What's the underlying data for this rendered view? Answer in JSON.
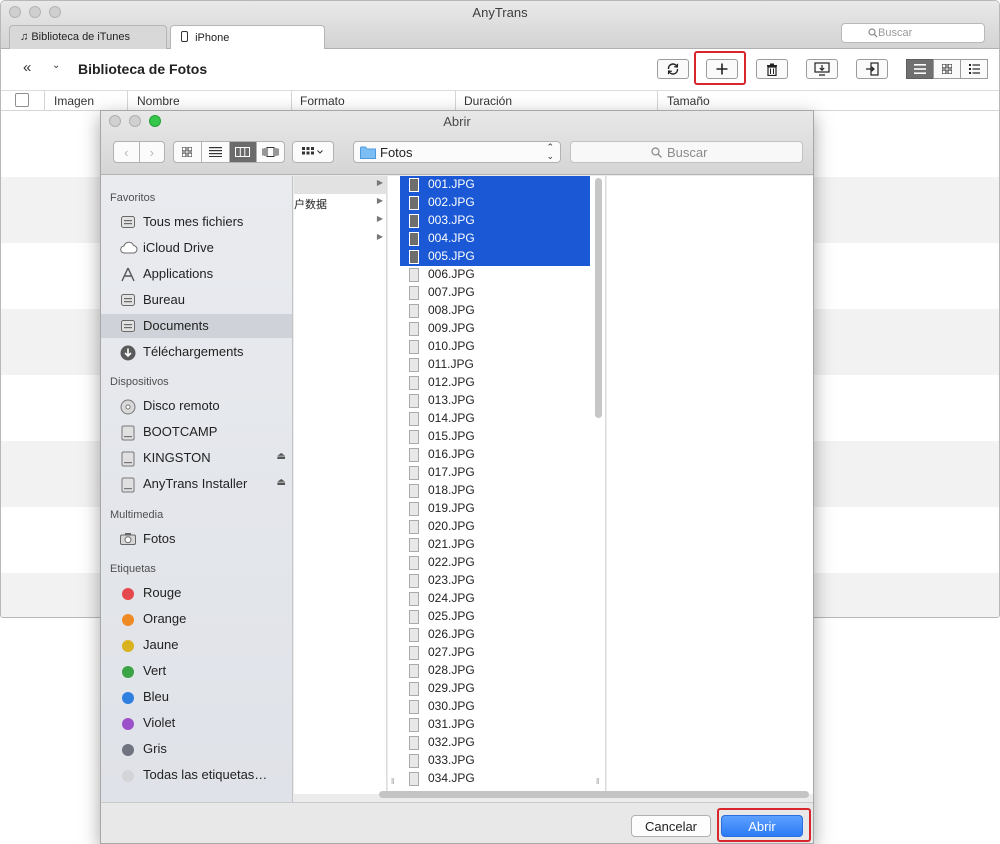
{
  "app": {
    "title": "AnyTrans",
    "tabs": [
      {
        "label": "Biblioteca de iTunes",
        "icon": "music-note-icon"
      },
      {
        "label": "iPhone",
        "icon": "iphone-icon"
      }
    ],
    "search_placeholder": "Buscar"
  },
  "toolbar": {
    "page_title": "Biblioteca de Fotos",
    "buttons": [
      "refresh-icon",
      "add-icon",
      "trash-icon",
      "to-computer-icon",
      "to-device-icon"
    ],
    "view_modes": [
      "list-view-icon",
      "grid-view-icon",
      "detail-view-icon"
    ],
    "highlight_color": "#d9262c"
  },
  "table": {
    "columns": [
      "Imagen",
      "Nombre",
      "Formato",
      "Duración",
      "Tamaño"
    ]
  },
  "dialog": {
    "title": "Abrir",
    "location": "Fotos",
    "search_placeholder": "Buscar",
    "sidebar": {
      "sections": [
        {
          "title": "Favoritos",
          "items": [
            {
              "label": "Tous mes fichiers",
              "icon": "all-files-icon"
            },
            {
              "label": "iCloud Drive",
              "icon": "cloud-icon"
            },
            {
              "label": "Applications",
              "icon": "applications-icon"
            },
            {
              "label": "Bureau",
              "icon": "desktop-icon"
            },
            {
              "label": "Documents",
              "icon": "documents-icon",
              "selected": true
            },
            {
              "label": "Téléchargements",
              "icon": "downloads-icon"
            }
          ]
        },
        {
          "title": "Dispositivos",
          "items": [
            {
              "label": "Disco remoto",
              "icon": "disc-icon"
            },
            {
              "label": "BOOTCAMP",
              "icon": "hard-drive-icon"
            },
            {
              "label": "KINGSTON",
              "icon": "drive-icon",
              "eject": true
            },
            {
              "label": "AnyTrans Installer",
              "icon": "drive-icon",
              "eject": true
            }
          ]
        },
        {
          "title": "Multimedia",
          "items": [
            {
              "label": "Fotos",
              "icon": "camera-icon"
            }
          ]
        },
        {
          "title": "Etiquetas",
          "items": [
            {
              "label": "Rouge",
              "color": "#e5484d"
            },
            {
              "label": "Orange",
              "color": "#f08a24"
            },
            {
              "label": "Jaune",
              "color": "#d9b21f"
            },
            {
              "label": "Vert",
              "color": "#3aa546"
            },
            {
              "label": "Bleu",
              "color": "#2f7fe0"
            },
            {
              "label": "Violet",
              "color": "#9b51c8"
            },
            {
              "label": "Gris",
              "color": "#6f7480"
            },
            {
              "label": "Todas las etiquetas…",
              "color": "#d2d4d8"
            }
          ]
        }
      ]
    },
    "column1": [
      "",
      "户数据",
      "",
      ""
    ],
    "files": [
      {
        "name": "001.JPG",
        "selected": true
      },
      {
        "name": "002.JPG",
        "selected": true
      },
      {
        "name": "003.JPG",
        "selected": true
      },
      {
        "name": "004.JPG",
        "selected": true
      },
      {
        "name": "005.JPG",
        "selected": true
      },
      {
        "name": "006.JPG"
      },
      {
        "name": "007.JPG"
      },
      {
        "name": "008.JPG"
      },
      {
        "name": "009.JPG"
      },
      {
        "name": "010.JPG"
      },
      {
        "name": "011.JPG"
      },
      {
        "name": "012.JPG"
      },
      {
        "name": "013.JPG"
      },
      {
        "name": "014.JPG"
      },
      {
        "name": "015.JPG"
      },
      {
        "name": "016.JPG"
      },
      {
        "name": "017.JPG"
      },
      {
        "name": "018.JPG"
      },
      {
        "name": "019.JPG"
      },
      {
        "name": "020.JPG"
      },
      {
        "name": "021.JPG"
      },
      {
        "name": "022.JPG"
      },
      {
        "name": "023.JPG"
      },
      {
        "name": "024.JPG"
      },
      {
        "name": "025.JPG"
      },
      {
        "name": "026.JPG"
      },
      {
        "name": "027.JPG"
      },
      {
        "name": "028.JPG"
      },
      {
        "name": "029.JPG"
      },
      {
        "name": "030.JPG"
      },
      {
        "name": "031.JPG"
      },
      {
        "name": "032.JPG"
      },
      {
        "name": "033.JPG"
      },
      {
        "name": "034.JPG"
      }
    ],
    "cancel_label": "Cancelar",
    "open_label": "Abrir",
    "selection_color": "#1a58d5"
  }
}
